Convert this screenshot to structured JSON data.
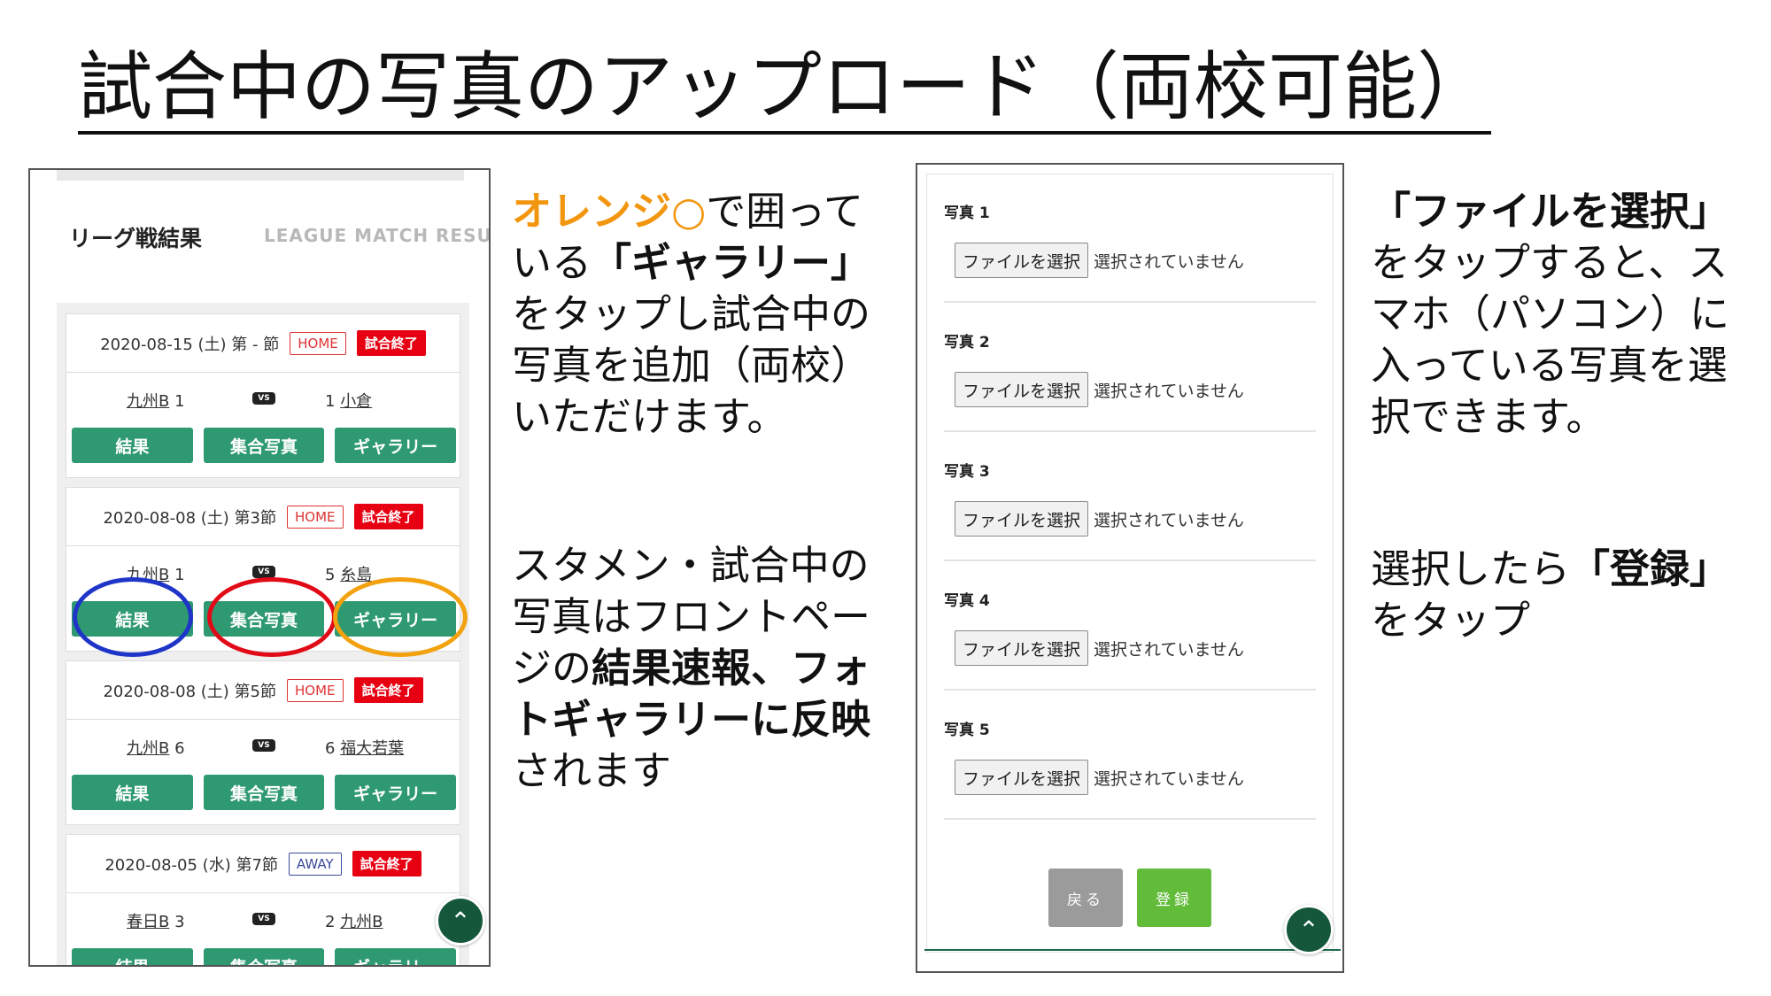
{
  "title": "試合中の写真のアップロード（両校可能）",
  "left_panel": {
    "header_jp": "リーグ戦結果",
    "header_en": "LEAGUE MATCH RESULT",
    "vs_label": "VS",
    "buttons": {
      "result": "結果",
      "group_photo": "集合写真",
      "gallery": "ギャラリー"
    },
    "matches": [
      {
        "date": "2020-08-15 (土) 第 - 節",
        "venue": "HOME",
        "status": "試合終了",
        "home_team": "九州B",
        "home_score": "1",
        "away_score": "1",
        "away_team": "小倉"
      },
      {
        "date": "2020-08-08 (土) 第3節",
        "venue": "HOME",
        "status": "試合終了",
        "home_team": "九州B",
        "home_score": "1",
        "away_score": "5",
        "away_team": "糸島"
      },
      {
        "date": "2020-08-08 (土) 第5節",
        "venue": "HOME",
        "status": "試合終了",
        "home_team": "九州B",
        "home_score": "6",
        "away_score": "6",
        "away_team": "福大若葉"
      },
      {
        "date": "2020-08-05 (水) 第7節",
        "venue": "AWAY",
        "status": "試合終了",
        "home_team": "春日B",
        "home_score": "3",
        "away_score": "2",
        "away_team": "九州B"
      }
    ],
    "scroll_top_icon": "chevron-up-icon"
  },
  "text_a": {
    "part1": "オレンジ○",
    "part2": "で囲っている",
    "part3": "「ギャラリー」",
    "part4": "をタップし試合中の写真を追加（両校）いただけます。"
  },
  "text_b": {
    "part1": "スタメン・試合中の写真はフロントページの",
    "part2": "結果速報、フォトギャラリーに反映",
    "part3": "されます"
  },
  "right_panel": {
    "fields": [
      {
        "label": "写真 1",
        "button": "ファイルを選択",
        "status": "選択されていません"
      },
      {
        "label": "写真 2",
        "button": "ファイルを選択",
        "status": "選択されていません"
      },
      {
        "label": "写真 3",
        "button": "ファイルを選択",
        "status": "選択されていません"
      },
      {
        "label": "写真 4",
        "button": "ファイルを選択",
        "status": "選択されていません"
      },
      {
        "label": "写真 5",
        "button": "ファイルを選択",
        "status": "選択されていません"
      }
    ],
    "back_button": "戻る",
    "submit_button": "登録",
    "scroll_top_icon": "chevron-up-icon"
  },
  "text_c": {
    "part1": "「ファイルを選択」",
    "part2": "をタップすると、スマホ（パソコン）に入っている写真を選択できます。"
  },
  "text_d": {
    "part1": "選択したら",
    "part2": "「登録」",
    "part3": "をタップ"
  },
  "colors": {
    "green_button": "#2f9a72",
    "status_red": "#e60012",
    "ring_blue": "#1f35c8",
    "ring_red": "#e10b17",
    "ring_orange": "#f2a10f",
    "submit_green": "#62bc3a",
    "back_gray": "#9b9b9b"
  }
}
